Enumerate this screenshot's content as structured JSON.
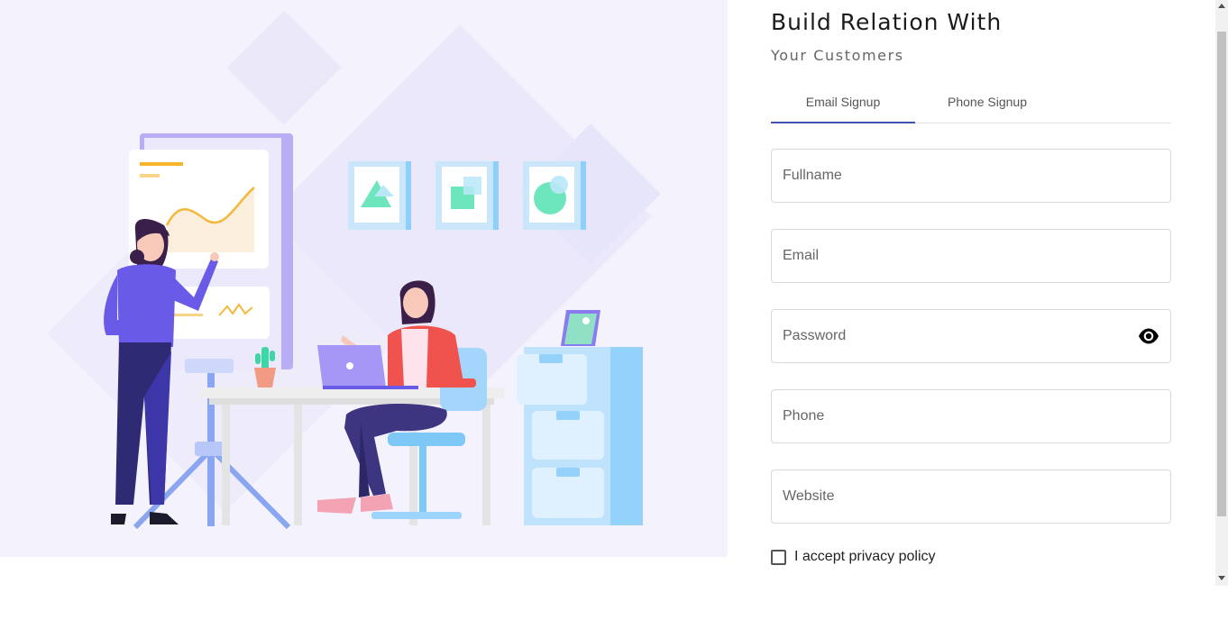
{
  "header": {
    "title": "Build Relation With",
    "subtitle": "Your Customers"
  },
  "tabs": [
    {
      "label": "Email Signup",
      "active": true
    },
    {
      "label": "Phone Signup",
      "active": false
    }
  ],
  "form": {
    "fullname_placeholder": "Fullname",
    "email_placeholder": "Email",
    "password_placeholder": "Password",
    "phone_placeholder": "Phone",
    "website_placeholder": "Website",
    "password_toggle_icon": "eye-icon"
  },
  "privacy": {
    "label": "I accept privacy policy",
    "checked": false
  },
  "illustration": {
    "name": "office-team-illustration"
  },
  "colors": {
    "accent": "#3f51b5",
    "hero_background": "#f4f2fd"
  }
}
